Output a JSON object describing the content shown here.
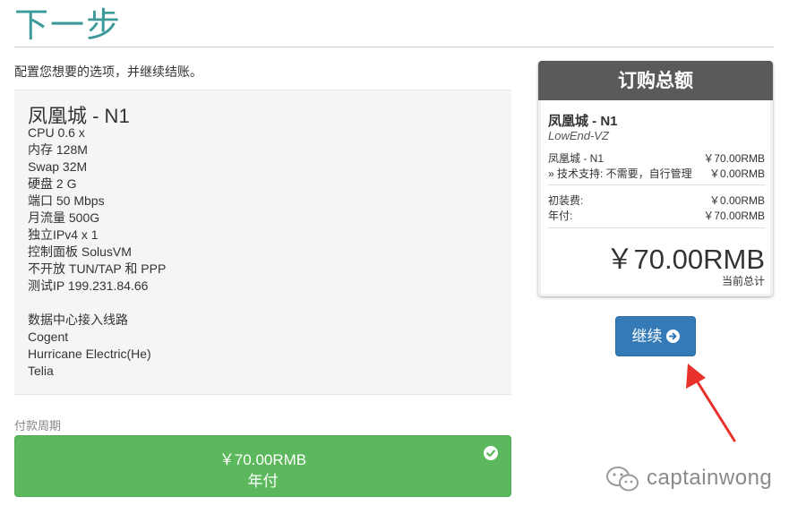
{
  "page": {
    "title": "下一步",
    "intro": "配置您想要的选项，并继续结账。"
  },
  "product": {
    "name": "凤凰城 - N1",
    "specs": [
      "CPU 0.6 x",
      "内存 128M",
      "Swap 32M",
      "硬盘 2 G",
      "端口 50 Mbps",
      "月流量 500G",
      "独立IPv4 x 1",
      "控制面板 SolusVM",
      "不开放 TUN/TAP 和 PPP",
      "测试IP 199.231.84.66"
    ],
    "datacenter_title": "数据中心接入线路",
    "datacenter_lines": [
      "Cogent",
      "Hurricane Electric(He)",
      "Telia"
    ]
  },
  "billing": {
    "label": "付款周期",
    "option_price": "￥70.00RMB",
    "option_cycle": "年付",
    "selected": true
  },
  "summary": {
    "header": "订购总额",
    "product": "凤凰城 - N1",
    "group": "LowEnd-VZ",
    "line_item_label": "凤凰城 - N1",
    "line_item_price": "￥70.00RMB",
    "support_label": "» 技术支持: 不需要，自行管理",
    "support_price": "￥0.00RMB",
    "setup_label": "初装费:",
    "setup_price": "￥0.00RMB",
    "annual_label": "年付:",
    "annual_price": "￥70.00RMB",
    "total": "￥70.00RMB",
    "total_label": "当前总计"
  },
  "actions": {
    "continue_label": "继续"
  },
  "watermark": {
    "text": "captainwong"
  },
  "colors": {
    "title": "#3c9a9a",
    "billing_selected": "#5cb85c",
    "primary_button": "#337ab7",
    "summary_header": "#5a5a5a",
    "annotation_arrow": "#e8312a"
  }
}
